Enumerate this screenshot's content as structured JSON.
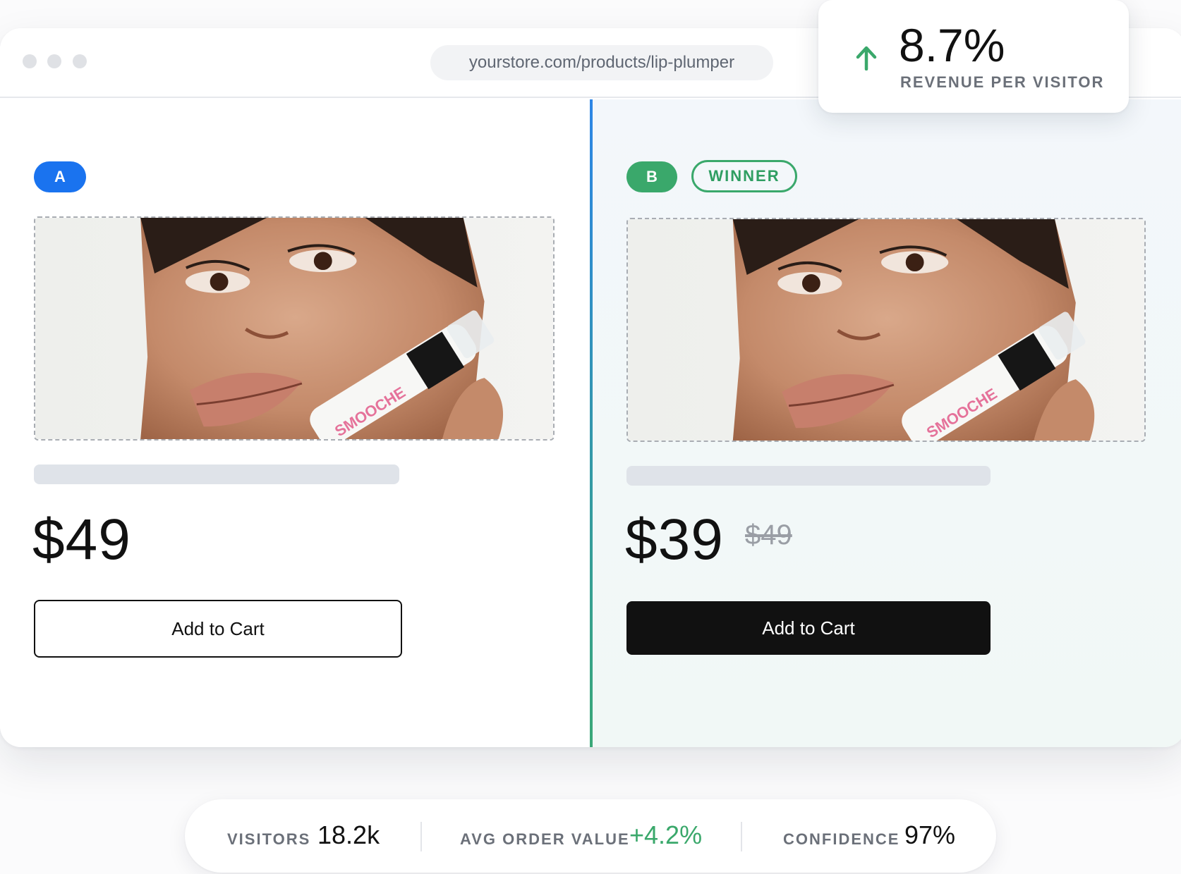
{
  "browser": {
    "url": "yourstore.com/products/lip-plumper"
  },
  "variant_a": {
    "badge": "A",
    "price": "$49",
    "cart_label": "Add to Cart"
  },
  "variant_b": {
    "badge": "B",
    "winner_label": "WINNER",
    "price": "$39",
    "old_price": "$49",
    "cart_label": "Add to Cart"
  },
  "product_image": {
    "brand_text": "SMOOCHE"
  },
  "metric": {
    "value": "8.7%",
    "label": "REVENUE PER VISITOR",
    "trend": "up"
  },
  "stats": [
    {
      "label": "VISITORS",
      "value": "18.2k"
    },
    {
      "label": "AVG ORDER VALUE",
      "value": "+4.2%"
    },
    {
      "label": "CONFIDENCE",
      "value": "97%"
    }
  ],
  "colors": {
    "variant_a": "#1a73ef",
    "variant_b": "#3aa86b",
    "positive": "#3aa86b"
  }
}
